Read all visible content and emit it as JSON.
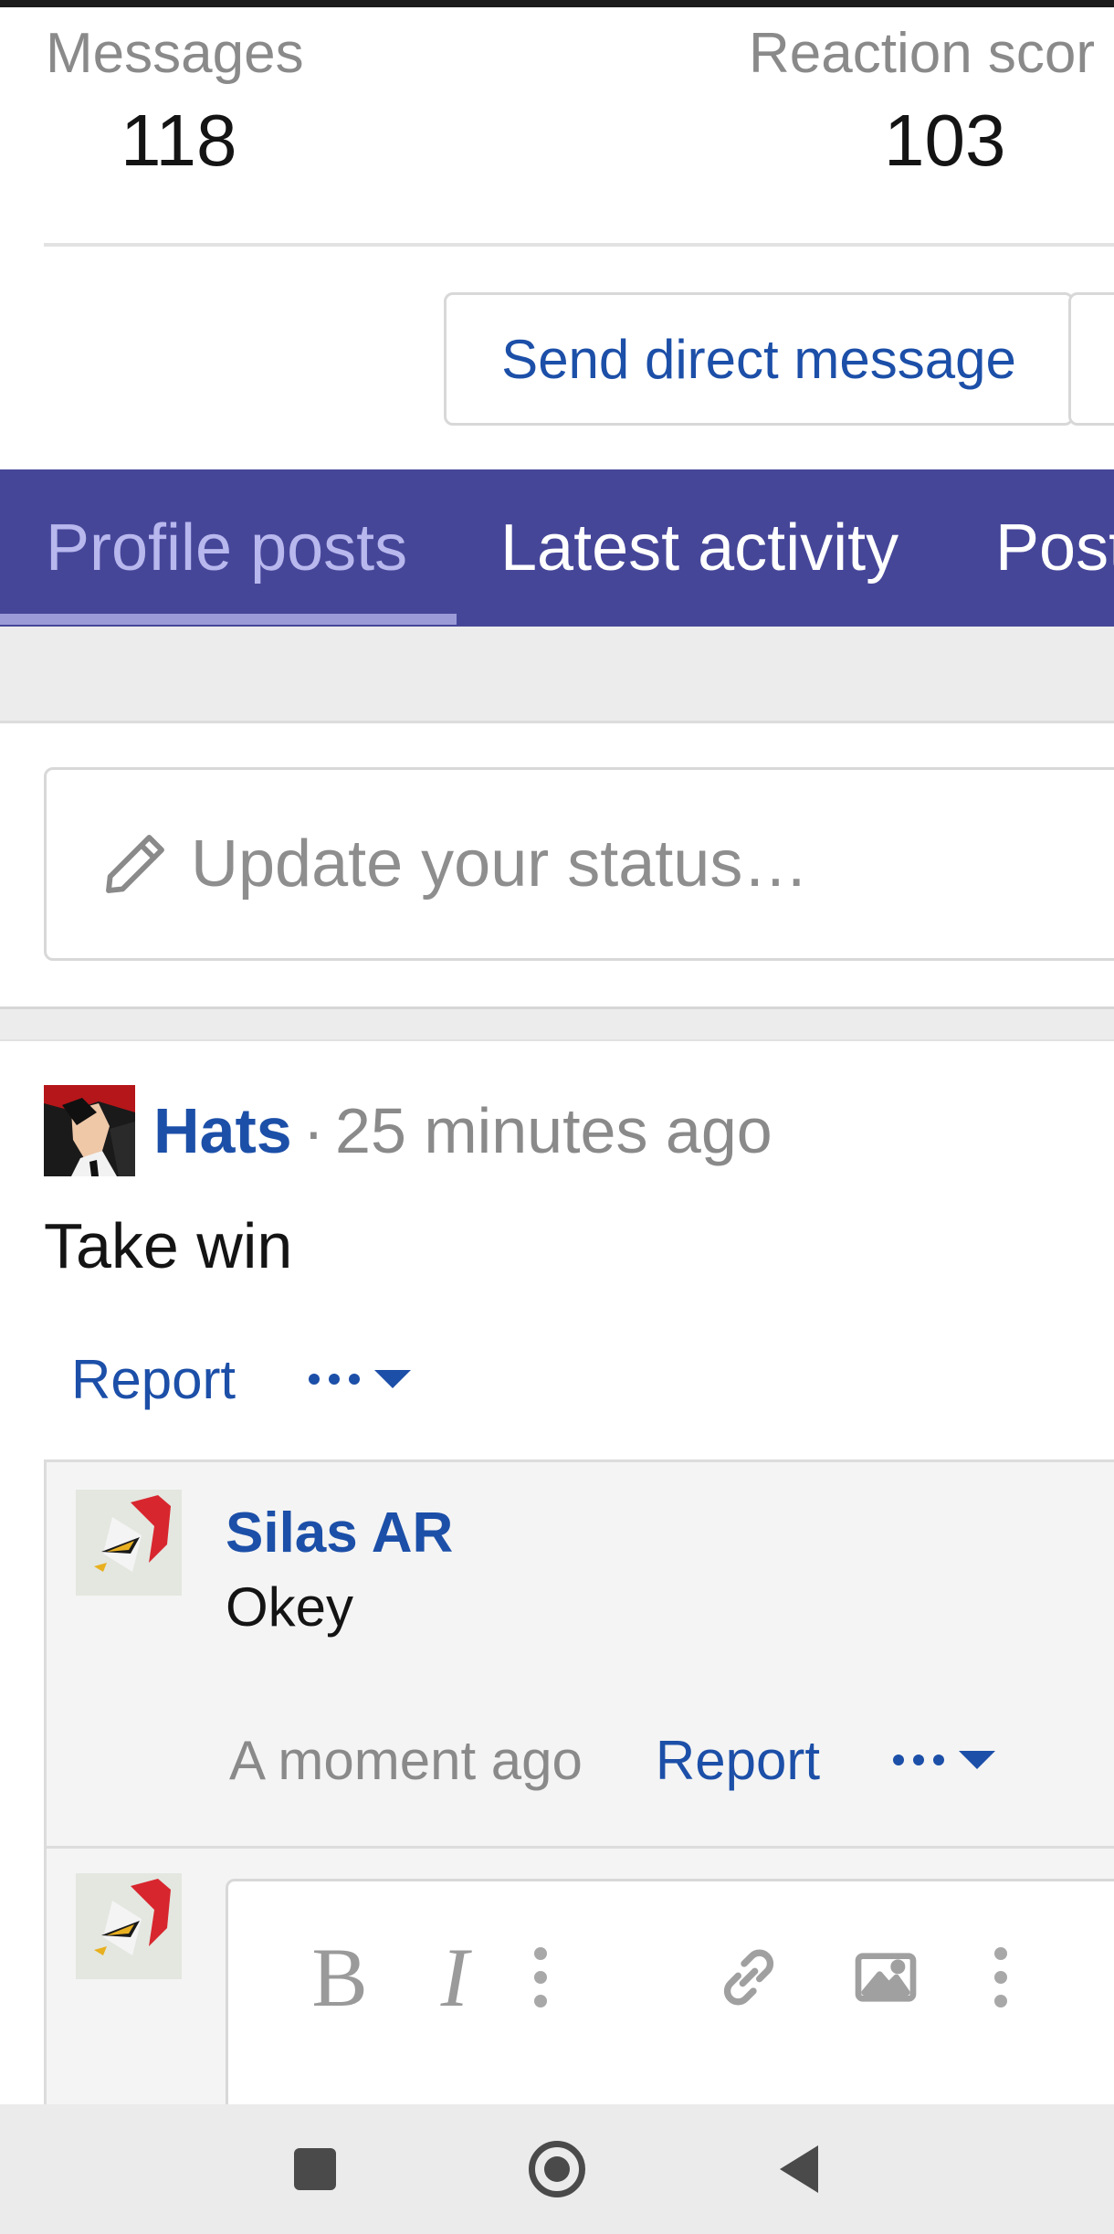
{
  "stats": {
    "messages_label": "Messages",
    "messages_value": "118",
    "reactions_label": "Reaction scor",
    "reactions_value": "103"
  },
  "actions": {
    "send_dm_label": "Send direct message"
  },
  "tabs": [
    {
      "label": "Profile posts",
      "active": true
    },
    {
      "label": "Latest activity",
      "active": false
    },
    {
      "label": "Post",
      "active": false
    }
  ],
  "status": {
    "placeholder": "Update your status…",
    "icon": "pencil-icon"
  },
  "post": {
    "author": "Hats",
    "separator": "·",
    "time": "25 minutes ago",
    "body": "Take win",
    "report_label": "Report",
    "more_icon": "more-dots-icon"
  },
  "comment": {
    "author": "Silas AR",
    "body": "Okey",
    "time": "A moment ago",
    "report_label": "Report"
  },
  "editor": {
    "bold_label": "B",
    "italic_label": "I",
    "tools": [
      "bold-icon",
      "italic-icon",
      "more-options-icon",
      "link-icon",
      "image-icon",
      "more-options-icon"
    ]
  },
  "navbar": {
    "buttons": [
      "recents-icon",
      "home-icon",
      "back-icon"
    ]
  },
  "colors": {
    "accent": "#464699",
    "link": "#1c4fa8",
    "muted": "#8a8a8a",
    "active_tab": "#b8b8ee"
  }
}
